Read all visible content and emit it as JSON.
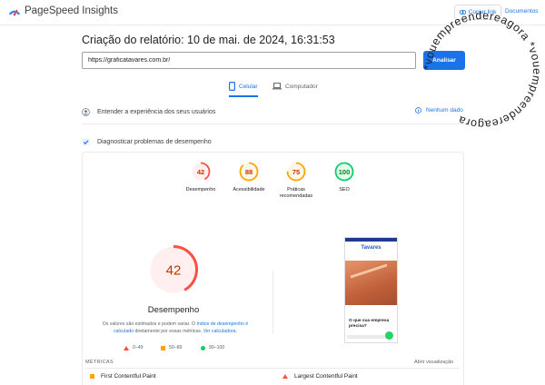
{
  "app": {
    "name": "PageSpeed Insights",
    "copy_link_label": "Copiar link",
    "docs_label": "Documentos"
  },
  "report": {
    "title": "Criação do relatório: 10 de mai. de 2024, 16:31:53",
    "url_value": "https://graficatavares.com.br/",
    "analyze_label": "Analisar"
  },
  "tabs": [
    {
      "label": "Celular",
      "active": true,
      "icon": "smartphone-icon"
    },
    {
      "label": "Computador",
      "active": false,
      "icon": "laptop-icon"
    }
  ],
  "sections": {
    "experience": {
      "label": "Entender a experiência dos seus usuários",
      "status": "Nenhum dado"
    },
    "diagnose": {
      "label": "Diagnosticar problemas de desempenho"
    }
  },
  "scores": [
    {
      "name": "Desempenho",
      "value": 42,
      "color": "#ff4e42"
    },
    {
      "name": "Acessibilidade",
      "value": 88,
      "color": "#ffa400"
    },
    {
      "name": "Práticas recomendadas",
      "value": 75,
      "color": "#ffa400"
    },
    {
      "name": "SEO",
      "value": 100,
      "color": "#0cce6b"
    }
  ],
  "performance": {
    "score": 42,
    "title": "Desempenho",
    "desc_prefix": "Os valores são estimados e podem variar. O ",
    "desc_link1": "índice de desempenho é calculado",
    "desc_mid": " diretamente por essas métricas. ",
    "desc_link2": "Ver calculadora."
  },
  "legend": [
    {
      "range": "0–49",
      "shape": "triangle",
      "color": "#ff4e42"
    },
    {
      "range": "50–89",
      "shape": "square",
      "color": "#ffa400"
    },
    {
      "range": "90–100",
      "shape": "circle",
      "color": "#0cce6b"
    }
  ],
  "preview": {
    "logo_text": "Tavares",
    "caption": "O que sua empresa precisa?"
  },
  "metrics": {
    "heading": "MÉTRICAS",
    "expand_label": "Abrir visualização",
    "items": [
      {
        "label": "First Contentful Paint",
        "shape": "square"
      },
      {
        "label": "Largest Contentful Paint",
        "shape": "triangle"
      }
    ]
  },
  "stamp": {
    "text": "*vouempreendereagora *vouempreendereagora "
  }
}
